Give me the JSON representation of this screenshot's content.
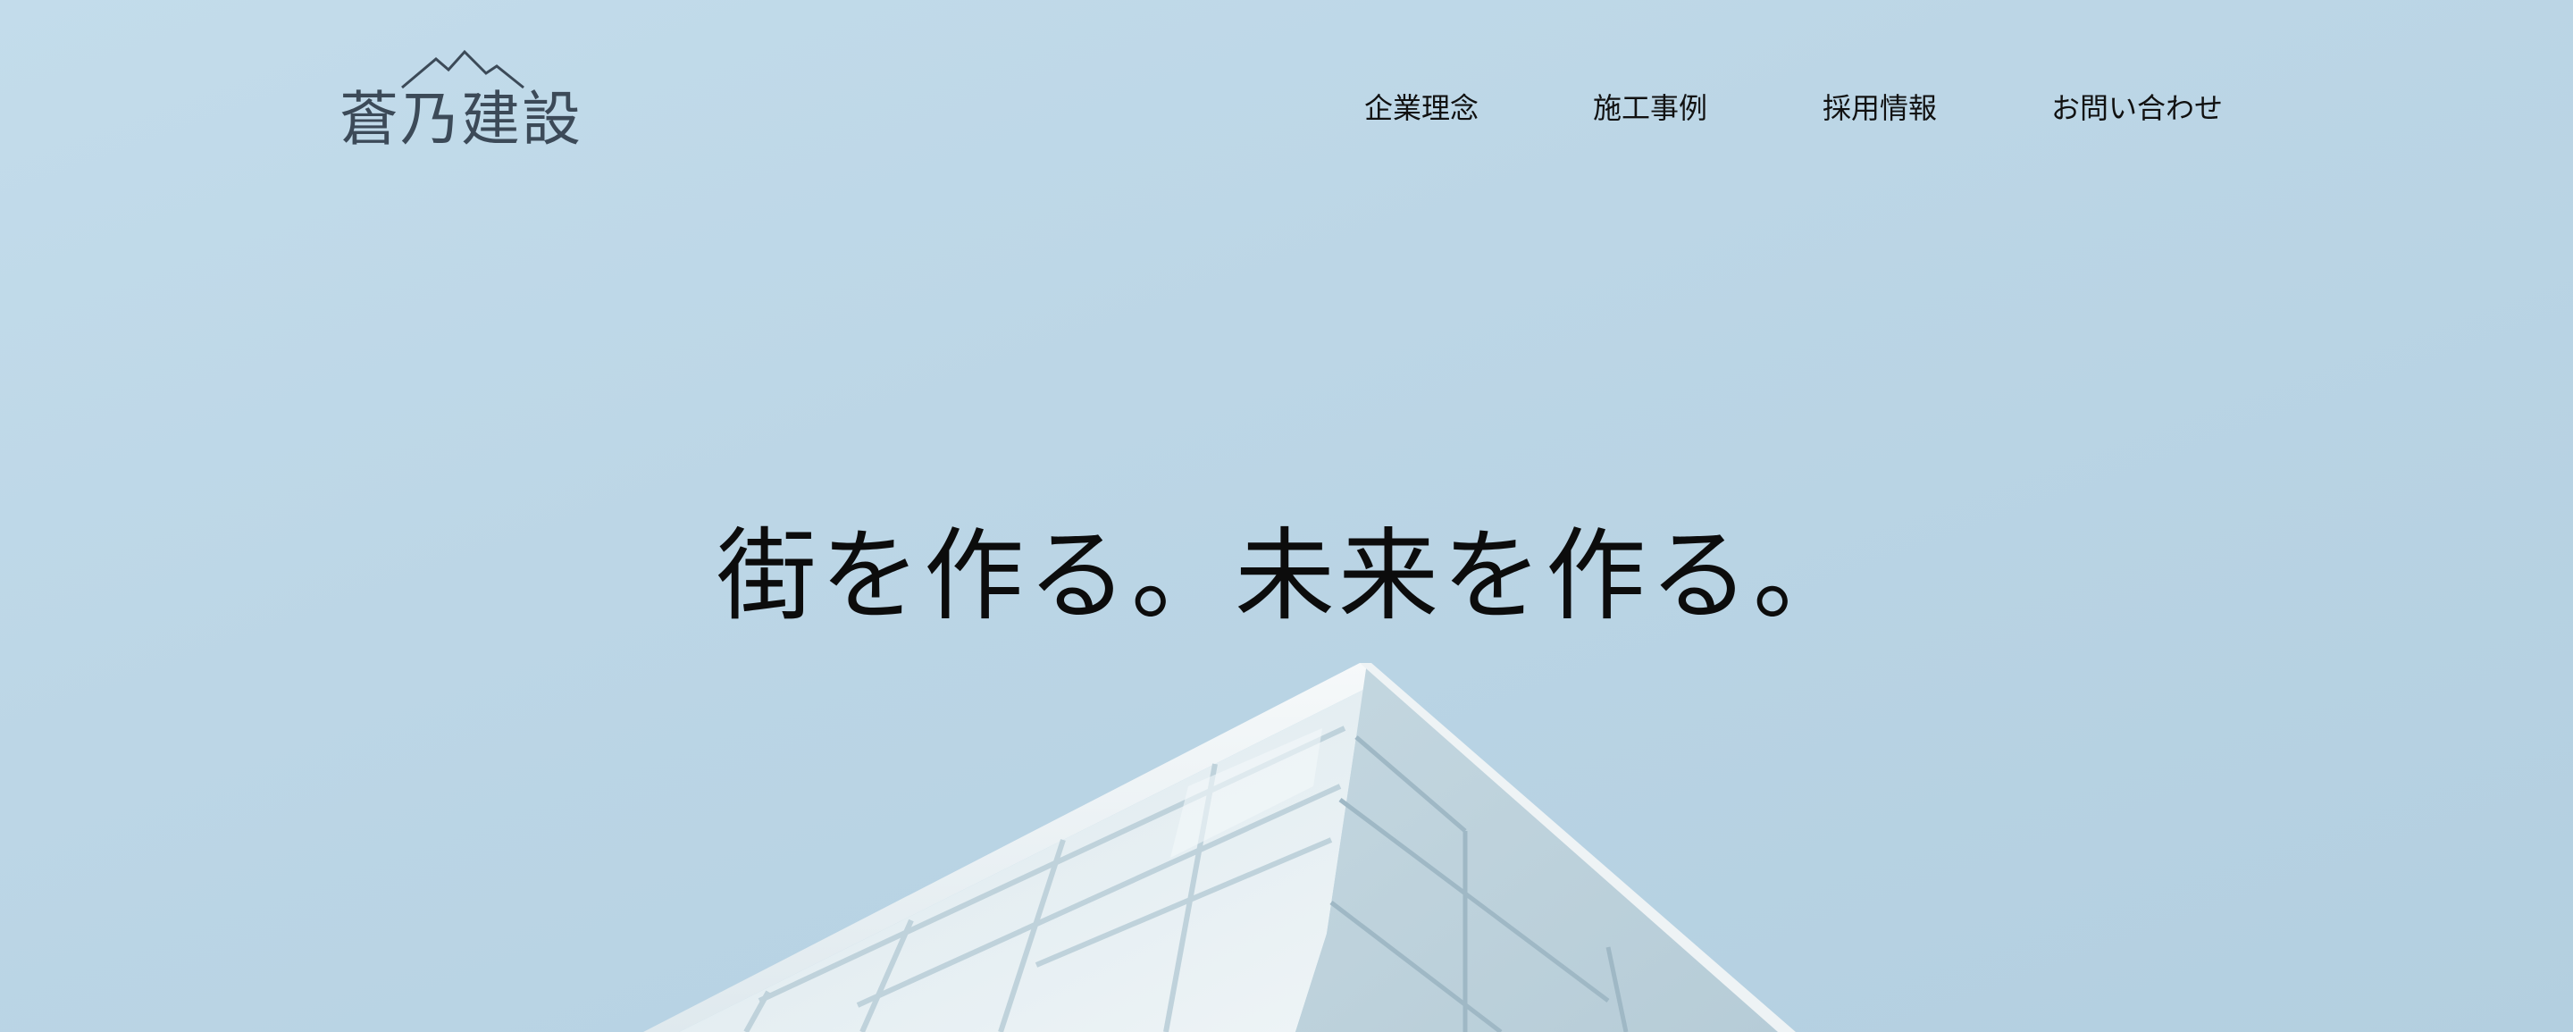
{
  "header": {
    "logo": {
      "text": "蒼乃建設",
      "icon": "mountain-icon"
    },
    "nav": {
      "items": [
        {
          "label": "企業理念"
        },
        {
          "label": "施工事例"
        },
        {
          "label": "採用情報"
        },
        {
          "label": "お問い合わせ"
        }
      ]
    }
  },
  "hero": {
    "title": "街を作る。未来を作る。",
    "image": "building-corner-photo"
  },
  "colors": {
    "sky_light": "#c3dceb",
    "sky_dark": "#b3cfe0",
    "logo": "#3c4a58",
    "text": "#111111"
  }
}
